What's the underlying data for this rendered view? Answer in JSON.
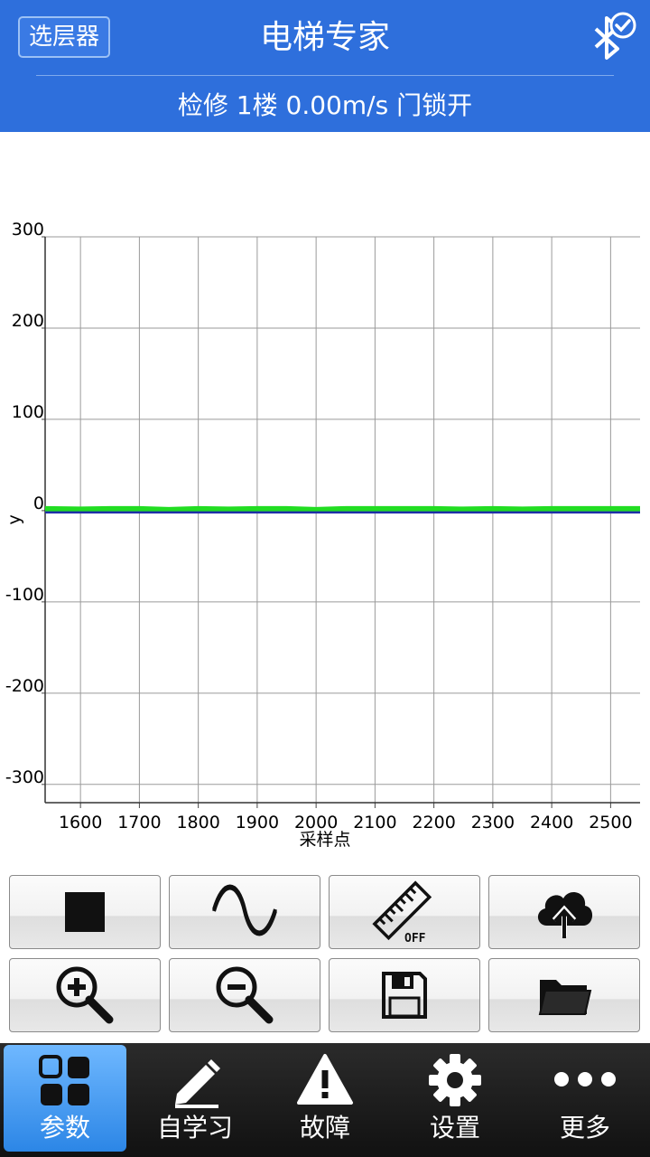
{
  "header": {
    "layer_button": "选层器",
    "title": "电梯专家",
    "status": "检修 1楼 0.00m/s 门锁开",
    "bluetooth_icon": "bluetooth-connected-icon"
  },
  "chart_data": {
    "type": "line",
    "xlabel": "采样点",
    "ylabel": "y",
    "xlim": [
      1540,
      2550
    ],
    "ylim": [
      -320,
      300
    ],
    "x_ticks": [
      1600,
      1700,
      1800,
      1900,
      2000,
      2100,
      2200,
      2300,
      2400,
      2500
    ],
    "y_ticks": [
      300,
      200,
      100,
      0,
      -100,
      -200,
      -300
    ],
    "grid": true,
    "series": [
      {
        "color": "#22dd22",
        "x": [
          1540,
          1600,
          1650,
          1700,
          1750,
          1800,
          1850,
          1900,
          1950,
          2000,
          2050,
          2100,
          2150,
          2200,
          2250,
          2300,
          2350,
          2400,
          2450,
          2500,
          2550
        ],
        "y": [
          2,
          1.5,
          2,
          2,
          1,
          2,
          1.5,
          2,
          2,
          1,
          2,
          2,
          2,
          2,
          1.5,
          2,
          1.5,
          2,
          2,
          2,
          2
        ]
      },
      {
        "color": "#1f2fa8",
        "x": [
          1540,
          2550
        ],
        "y": [
          -2,
          -2
        ]
      }
    ]
  },
  "toolbar": [
    {
      "icon": "stop-icon"
    },
    {
      "icon": "waveform-icon"
    },
    {
      "icon": "ruler-off-icon"
    },
    {
      "icon": "cloud-upload-icon"
    },
    {
      "icon": "zoom-in-icon"
    },
    {
      "icon": "zoom-out-icon"
    },
    {
      "icon": "save-floppy-icon"
    },
    {
      "icon": "folder-icon"
    }
  ],
  "bottom_nav": [
    {
      "label": "参数",
      "icon": "grid-icon",
      "active": true
    },
    {
      "label": "自学习",
      "icon": "pencil-icon",
      "active": false
    },
    {
      "label": "故障",
      "icon": "warning-icon",
      "active": false
    },
    {
      "label": "设置",
      "icon": "gear-icon",
      "active": false
    },
    {
      "label": "更多",
      "icon": "more-dots-icon",
      "active": false
    }
  ],
  "colors": {
    "header_bg": "#2e6fdc",
    "nav_active": "#3a96f0",
    "series_green": "#22dd22",
    "series_blue": "#1f2fa8"
  }
}
